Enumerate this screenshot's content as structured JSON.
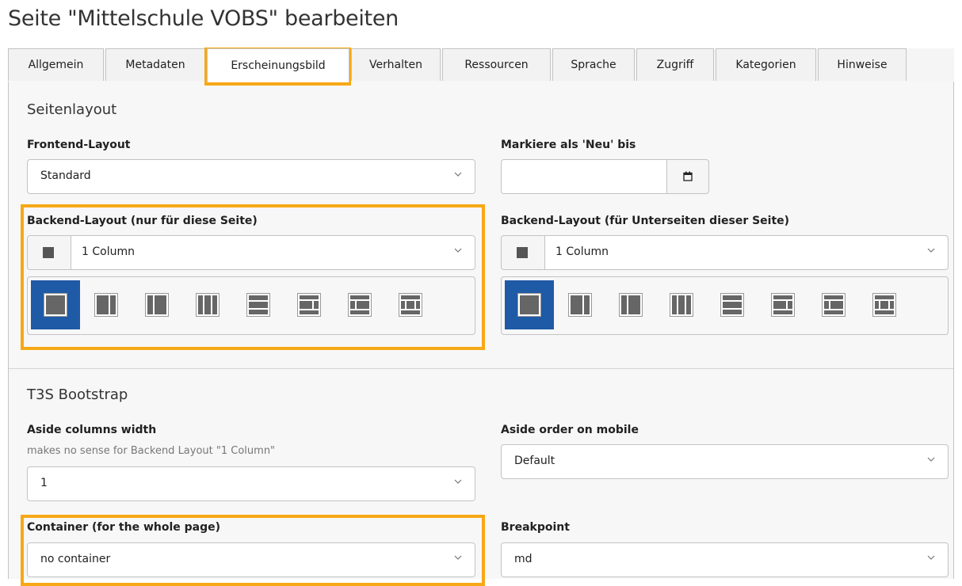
{
  "title": "Seite \"Mittelschule VOBS\" bearbeiten",
  "tabs": [
    {
      "label": "Allgemein"
    },
    {
      "label": "Metadaten"
    },
    {
      "label": "Erscheinungsbild"
    },
    {
      "label": "Verhalten"
    },
    {
      "label": "Ressourcen"
    },
    {
      "label": "Sprache"
    },
    {
      "label": "Zugriff"
    },
    {
      "label": "Kategorien"
    },
    {
      "label": "Hinweise"
    }
  ],
  "active_tab": "Erscheinungsbild",
  "section1": {
    "title": "Seitenlayout",
    "frontend_layout": {
      "label": "Frontend-Layout",
      "value": "Standard"
    },
    "new_until": {
      "label": "Markiere als 'Neu' bis",
      "value": ""
    },
    "backend_layout": {
      "label": "Backend-Layout (nur für diese Seite)",
      "value": "1 Column"
    },
    "backend_layout_sub": {
      "label": "Backend-Layout (für Unterseiten dieser Seite)",
      "value": "1 Column"
    }
  },
  "section2": {
    "title": "T3S Bootstrap",
    "aside_width": {
      "label": "Aside columns width",
      "hint": "makes no sense for Backend Layout \"1 Column\"",
      "value": "1"
    },
    "aside_order": {
      "label": "Aside order on mobile",
      "value": "Default"
    },
    "container": {
      "label": "Container (for the whole page)",
      "value": "no container"
    },
    "breakpoint": {
      "label": "Breakpoint",
      "value": "md"
    }
  },
  "colors": {
    "highlight": "#f7a816",
    "selected": "#1f5aa6"
  },
  "icons": [
    "calendar-icon",
    "chevron-down-icon",
    "layout-icon"
  ]
}
